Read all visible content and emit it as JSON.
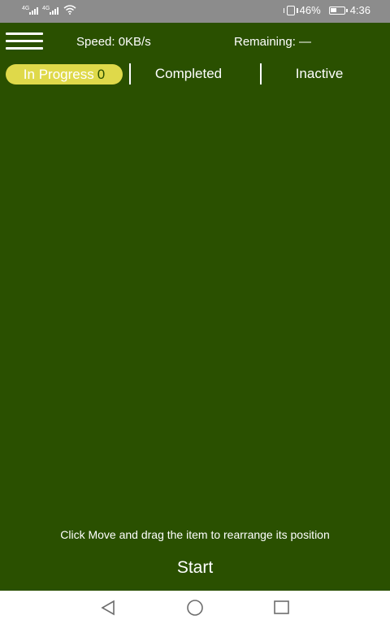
{
  "status_bar": {
    "signal_1_label": "4G",
    "signal_2_label": "4G",
    "battery_percent": "46%",
    "battery_level": 0.46,
    "time": "4:36",
    "icons": [
      "signal-icon",
      "signal-icon",
      "wifi-icon",
      "vibrate-icon",
      "battery-icon"
    ]
  },
  "header": {
    "speed": "Speed: 0KB/s",
    "remaining": "Remaining: —"
  },
  "tabs": {
    "in_progress_label": "In Progress",
    "in_progress_count": "0",
    "completed_label": "Completed",
    "inactive_label": "Inactive"
  },
  "main": {
    "hint": "Click Move and drag the item to rearrange its position",
    "start_label": "Start"
  },
  "nav": {
    "icons": [
      "back-icon",
      "home-icon",
      "recents-icon"
    ]
  },
  "colors": {
    "background": "#2a5000",
    "active_tab": "#dfd94a",
    "status_bar": "#8c8c8c"
  }
}
